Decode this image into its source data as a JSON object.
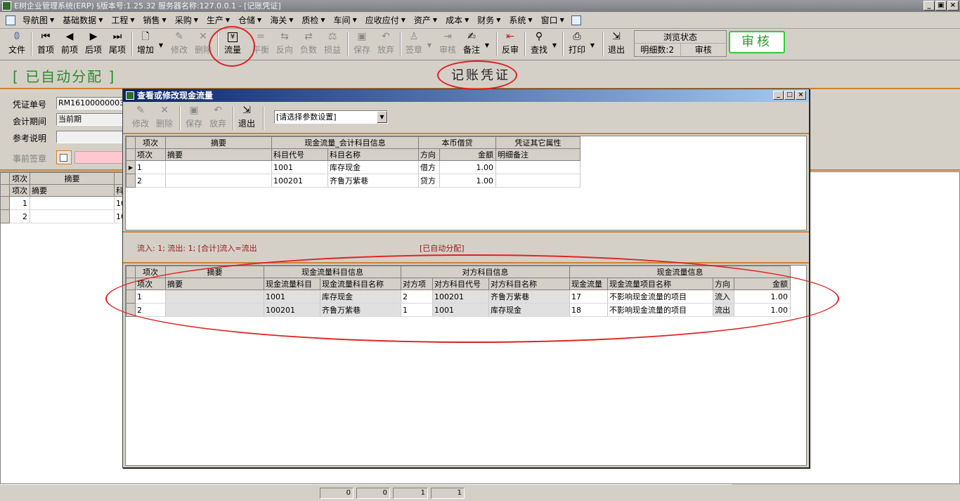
{
  "window": {
    "title": "E树企业管理系统(ERP)  §版本号:1.25.32  服务器名称:127.0.0.1 - [记账凭证]",
    "buttons": [
      "_",
      "▣",
      "×"
    ]
  },
  "menu": [
    "导航图",
    "基础数据",
    "工程",
    "销售",
    "采购",
    "生产",
    "仓储",
    "海关",
    "质检",
    "车间",
    "应收应付",
    "资产",
    "成本",
    "财务",
    "系统",
    "窗口"
  ],
  "toolbar": {
    "file": "文件",
    "first": "首项",
    "prev": "前项",
    "next": "后项",
    "last": "尾项",
    "add": "增加",
    "edit": "修改",
    "delete": "删除",
    "cashflow": "流量",
    "balance": "平衡",
    "reverse": "反向",
    "negative": "负数",
    "profit_loss": "损益",
    "save": "保存",
    "discard": "放弃",
    "sign": "签章",
    "review": "审核",
    "note": "备注",
    "unreview": "反审",
    "find": "查找",
    "print": "打印",
    "exit": "退出"
  },
  "status": {
    "browse_state": "浏览状态",
    "detail_count": "明细数:2",
    "state_value": "审核",
    "audit_badge": "审核"
  },
  "voucher": {
    "auto_tag": "[ 已自动分配 ]",
    "title": "记账凭证",
    "fields": {
      "number_label": "凭证单号",
      "number_value": "RM16100000003",
      "period_label": "会计期间",
      "period_value": "当前期",
      "ref_label": "参考说明",
      "ref_value": "",
      "presign_label": "事前签章"
    },
    "grid": {
      "headers": [
        "项次",
        "摘要",
        "项次",
        "摘要",
        "科"
      ],
      "rows": [
        {
          "idx": "1",
          "summary": "",
          "acct": "10"
        },
        {
          "idx": "2",
          "summary": "",
          "acct": "10"
        }
      ]
    }
  },
  "dialog": {
    "title": "查看或修改现金流量",
    "toolbar": {
      "edit": "修改",
      "delete": "删除",
      "save": "保存",
      "discard": "放弃",
      "exit": "退出",
      "param_combo": "[请选择参数设置]"
    },
    "upper": {
      "group_headers": [
        "项次",
        "摘要",
        "现金流量_会计科目信息",
        "本币借贷",
        "凭证其它属性"
      ],
      "sub_headers": [
        "项次",
        "摘要",
        "科目代号",
        "科目名称",
        "方向",
        "金额",
        "明细备注"
      ],
      "rows": [
        {
          "idx": "1",
          "summary": "",
          "code": "1001",
          "name": "库存现金",
          "dir": "借方",
          "amount": "1.00",
          "note": ""
        },
        {
          "idx": "2",
          "summary": "",
          "code": "100201",
          "name": "齐鲁万紫巷",
          "dir": "贷方",
          "amount": "1.00",
          "note": ""
        }
      ]
    },
    "flow_summary": "流入: 1;  流出: 1;  [合计]流入=流出",
    "flow_status": "[已自动分配]",
    "lower": {
      "group_headers": [
        "项次",
        "摘要",
        "现金流量科目信息",
        "对方科目信息",
        "现金流量信息"
      ],
      "sub_headers": [
        "项次",
        "摘要",
        "现金流量科目",
        "现金流量科目名称",
        "对方项",
        "对方科目代号",
        "对方科目名称",
        "现金流量",
        "现金流量项目名称",
        "方向",
        "金额"
      ],
      "rows": [
        {
          "idx": "1",
          "summary": "",
          "cf_code": "1001",
          "cf_name": "库存现金",
          "opp_idx": "2",
          "opp_code": "100201",
          "opp_name": "齐鲁万紫巷",
          "cf_item": "17",
          "cf_item_name": "不影响现金流量的项目",
          "dir": "流入",
          "amount": "1.00"
        },
        {
          "idx": "2",
          "summary": "",
          "cf_code": "100201",
          "cf_name": "齐鲁万紫巷",
          "opp_idx": "1",
          "opp_code": "1001",
          "opp_name": "库存现金",
          "cf_item": "18",
          "cf_item_name": "不影响现金流量的项目",
          "dir": "流出",
          "amount": "1.00"
        }
      ]
    }
  },
  "footer": {
    "cells": [
      "0",
      "0",
      "1",
      "1"
    ]
  },
  "colors": {
    "accent_green": "#2e8b2e",
    "annotation_red": "#e02020",
    "dialog_title": "#0a246a",
    "divider_orange": "#d08030"
  }
}
